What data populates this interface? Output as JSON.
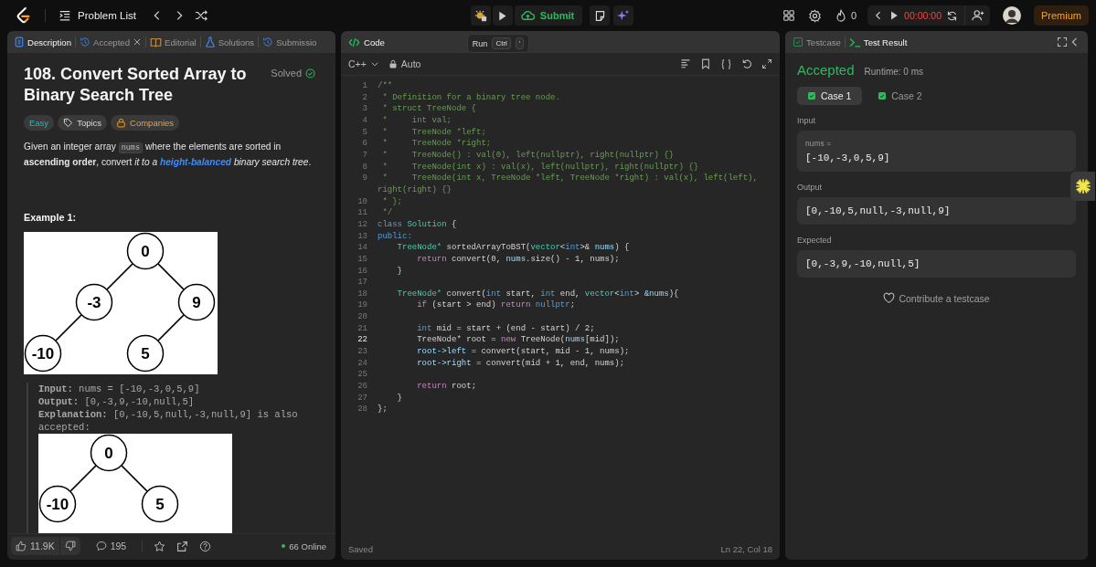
{
  "topbar": {
    "problem_list": "Problem List",
    "submit": "Submit",
    "run_tooltip": {
      "label": "Run",
      "keys": [
        "Ctrl",
        "'"
      ]
    },
    "streak": "0",
    "timer": "00:00:00",
    "premium": "Premium"
  },
  "description_panel": {
    "tabs": [
      {
        "label": "Description",
        "kind": "description",
        "selected": true,
        "closable": false
      },
      {
        "label": "Accepted",
        "kind": "accepted",
        "selected": false,
        "closable": true
      },
      {
        "label": "Editorial",
        "kind": "editorial",
        "selected": false,
        "closable": false
      },
      {
        "label": "Solutions",
        "kind": "solutions",
        "selected": false,
        "closable": false
      },
      {
        "label": "Submissio",
        "kind": "submissions",
        "selected": false,
        "closable": false
      }
    ],
    "title": "108. Convert Sorted Array to Binary Search Tree",
    "status": "Solved",
    "tags": [
      {
        "label": "Easy",
        "kind": "difficulty"
      },
      {
        "label": "Topics",
        "kind": "topics"
      },
      {
        "label": "Companies",
        "kind": "companies"
      }
    ],
    "statement": [
      {
        "kind": "text",
        "text": "Given an integer array "
      },
      {
        "kind": "code",
        "text": "nums"
      },
      {
        "kind": "text",
        "text": " where the elements are sorted in **ascending order**, convert *it to a* "
      },
      {
        "kind": "link",
        "text": "height-balanced"
      },
      {
        "kind": "text",
        "text": " *binary search tree*."
      }
    ],
    "example_title": "Example 1:",
    "example_tree": {
      "label": "0",
      "left": {
        "label": "-3",
        "left": {
          "label": "-10"
        }
      },
      "right": {
        "label": "9",
        "left": {
          "label": "5"
        }
      }
    },
    "example_lines": [
      "**Input:** nums = [-10,-3,0,5,9]",
      "**Output:** [0,-3,9,-10,null,5]",
      "**Explanation:** [0,-10,5,null,-3,null,9] is also accepted:"
    ],
    "explanation_tree": {
      "label": "0",
      "left": {
        "label": "-10"
      },
      "right": {
        "label": "5"
      }
    },
    "footer": {
      "likes": "11.9K",
      "comments": "195",
      "online": "66 Online"
    }
  },
  "code_panel": {
    "title": "Code",
    "language": "C++",
    "mode": "Auto",
    "saved": "Saved",
    "cursor": "Ln 22, Col 18",
    "lines": [
      {
        "number": "1",
        "active": false,
        "tokens": [
          {
            "text": "/**",
            "kind": "comment"
          }
        ]
      },
      {
        "number": "2",
        "active": false,
        "tokens": [
          {
            "text": " * Definition for a binary tree node.",
            "kind": "comment"
          }
        ]
      },
      {
        "number": "3",
        "active": false,
        "tokens": [
          {
            "text": " * struct TreeNode {",
            "kind": "comment"
          }
        ]
      },
      {
        "number": "4",
        "active": false,
        "tokens": [
          {
            "text": " *     int val;",
            "kind": "comment"
          }
        ]
      },
      {
        "number": "5",
        "active": false,
        "tokens": [
          {
            "text": " *     TreeNode *left;",
            "kind": "comment"
          }
        ]
      },
      {
        "number": "6",
        "active": false,
        "tokens": [
          {
            "text": " *     TreeNode *right;",
            "kind": "comment"
          }
        ]
      },
      {
        "number": "7",
        "active": false,
        "tokens": [
          {
            "text": " *     TreeNode() : val(0), left(nullptr), right(nullptr) {}",
            "kind": "comment"
          }
        ]
      },
      {
        "number": "8",
        "active": false,
        "tokens": [
          {
            "text": " *     TreeNode(int x) : val(x), left(nullptr), right(nullptr) {}",
            "kind": "comment"
          }
        ]
      },
      {
        "number": "9",
        "active": false,
        "tokens": [
          {
            "text": " *     TreeNode(int x, TreeNode *left, TreeNode *right) : val(x), left(left), right(right) {}",
            "kind": "comment"
          }
        ]
      },
      {
        "number": "10",
        "active": false,
        "tokens": [
          {
            "text": " * };",
            "kind": "comment"
          }
        ]
      },
      {
        "number": "11",
        "active": false,
        "tokens": [
          {
            "text": " */",
            "kind": "comment"
          }
        ]
      },
      {
        "number": "12",
        "active": false,
        "tokens": [
          {
            "text": "class",
            "kind": "keyword"
          },
          {
            "text": " Solution",
            "kind": "type"
          },
          {
            "text": " {",
            "kind": "plain"
          }
        ]
      },
      {
        "number": "13",
        "active": false,
        "tokens": [
          {
            "text": "public:",
            "kind": "keyword"
          }
        ]
      },
      {
        "number": "14",
        "active": false,
        "tokens": [
          {
            "text": "    TreeNode*",
            "kind": "type"
          },
          {
            "text": " sortedArrayToBST(",
            "kind": "plain"
          },
          {
            "text": "vector",
            "kind": "type"
          },
          {
            "text": "<",
            "kind": "plain"
          },
          {
            "text": "int",
            "kind": "keyword"
          },
          {
            "text": ">& ",
            "kind": "plain"
          },
          {
            "text": "nums",
            "kind": "variable"
          },
          {
            "text": ") {",
            "kind": "plain"
          }
        ]
      },
      {
        "number": "15",
        "active": false,
        "tokens": [
          {
            "text": "        return",
            "kind": "control"
          },
          {
            "text": " convert(0, ",
            "kind": "plain"
          },
          {
            "text": "nums",
            "kind": "variable"
          },
          {
            "text": ".size() - 1, nums);",
            "kind": "plain"
          }
        ]
      },
      {
        "number": "16",
        "active": false,
        "tokens": [
          {
            "text": "    }",
            "kind": "plain"
          }
        ]
      },
      {
        "number": "17",
        "active": false
      },
      {
        "number": "18",
        "active": false,
        "tokens": [
          {
            "text": "    TreeNode*",
            "kind": "type"
          },
          {
            "text": " convert(",
            "kind": "plain"
          },
          {
            "text": "int",
            "kind": "keyword"
          },
          {
            "text": " start, ",
            "kind": "plain"
          },
          {
            "text": "int",
            "kind": "keyword"
          },
          {
            "text": " end, ",
            "kind": "plain"
          },
          {
            "text": "vector",
            "kind": "type"
          },
          {
            "text": "<",
            "kind": "plain"
          },
          {
            "text": "int",
            "kind": "keyword"
          },
          {
            "text": ">",
            "kind": "plain"
          },
          {
            "text": " &nums",
            "kind": "variable"
          },
          {
            "text": "){",
            "kind": "plain"
          }
        ]
      },
      {
        "number": "19",
        "active": false,
        "tokens": [
          {
            "text": "        if",
            "kind": "control"
          },
          {
            "text": " (start > end) ",
            "kind": "plain"
          },
          {
            "text": "return",
            "kind": "control"
          },
          {
            "text": " nullptr",
            "kind": "keyword"
          },
          {
            "text": ";",
            "kind": "plain"
          }
        ]
      },
      {
        "number": "20",
        "active": false
      },
      {
        "number": "21",
        "active": false,
        "tokens": [
          {
            "text": "        int",
            "kind": "keyword"
          },
          {
            "text": " mid = start + (end - start) / 2;",
            "kind": "plain"
          }
        ]
      },
      {
        "number": "22",
        "active": true,
        "tokens": [
          {
            "text": "        TreeNode* root = ",
            "kind": "plain"
          },
          {
            "text": "new",
            "kind": "control"
          },
          {
            "text": " TreeNode(",
            "kind": "plain"
          },
          {
            "text": "nums",
            "kind": "variable"
          },
          {
            "text": "[mid]);",
            "kind": "plain"
          }
        ]
      },
      {
        "number": "23",
        "active": false,
        "tokens": [
          {
            "text": "        root->left",
            "kind": "variable"
          },
          {
            "text": " = convert(start, mid - 1, nums);",
            "kind": "plain"
          }
        ]
      },
      {
        "number": "24",
        "active": false,
        "tokens": [
          {
            "text": "        root->right",
            "kind": "variable"
          },
          {
            "text": " = convert(mid + 1, end, nums);",
            "kind": "plain"
          }
        ]
      },
      {
        "number": "25",
        "active": false
      },
      {
        "number": "26",
        "active": false,
        "tokens": [
          {
            "text": "        return",
            "kind": "control"
          },
          {
            "text": " root;",
            "kind": "plain"
          }
        ]
      },
      {
        "number": "27",
        "active": false,
        "tokens": [
          {
            "text": "    }",
            "kind": "plain"
          }
        ]
      },
      {
        "number": "28",
        "active": false,
        "tokens": [
          {
            "text": "};",
            "kind": "plain"
          }
        ]
      }
    ]
  },
  "result_panel": {
    "tabs": [
      {
        "label": "Testcase",
        "kind": "testcase",
        "selected": false
      },
      {
        "label": "Test Result",
        "kind": "result",
        "selected": true
      }
    ],
    "verdict": "Accepted",
    "runtime": "Runtime: 0 ms",
    "cases": [
      {
        "label": "Case 1",
        "selected": true,
        "passed": true
      },
      {
        "label": "Case 2",
        "selected": false,
        "passed": true
      }
    ],
    "sections": [
      {
        "label": "Input",
        "param": "nums =",
        "value": "[-10,-3,0,5,9]"
      },
      {
        "label": "Output",
        "value": "[0,-10,5,null,-3,null,9]"
      },
      {
        "label": "Expected",
        "value": "[0,-3,9,-10,null,5]"
      }
    ],
    "contribute": "Contribute a testcase"
  }
}
